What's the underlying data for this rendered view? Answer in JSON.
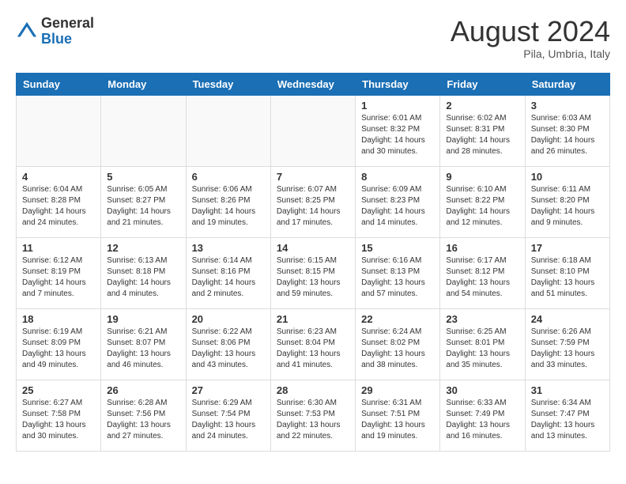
{
  "header": {
    "logo_general": "General",
    "logo_blue": "Blue",
    "month_title": "August 2024",
    "location": "Pila, Umbria, Italy"
  },
  "days_of_week": [
    "Sunday",
    "Monday",
    "Tuesday",
    "Wednesday",
    "Thursday",
    "Friday",
    "Saturday"
  ],
  "weeks": [
    [
      {
        "day": "",
        "info": ""
      },
      {
        "day": "",
        "info": ""
      },
      {
        "day": "",
        "info": ""
      },
      {
        "day": "",
        "info": ""
      },
      {
        "day": "1",
        "info": "Sunrise: 6:01 AM\nSunset: 8:32 PM\nDaylight: 14 hours\nand 30 minutes."
      },
      {
        "day": "2",
        "info": "Sunrise: 6:02 AM\nSunset: 8:31 PM\nDaylight: 14 hours\nand 28 minutes."
      },
      {
        "day": "3",
        "info": "Sunrise: 6:03 AM\nSunset: 8:30 PM\nDaylight: 14 hours\nand 26 minutes."
      }
    ],
    [
      {
        "day": "4",
        "info": "Sunrise: 6:04 AM\nSunset: 8:28 PM\nDaylight: 14 hours\nand 24 minutes."
      },
      {
        "day": "5",
        "info": "Sunrise: 6:05 AM\nSunset: 8:27 PM\nDaylight: 14 hours\nand 21 minutes."
      },
      {
        "day": "6",
        "info": "Sunrise: 6:06 AM\nSunset: 8:26 PM\nDaylight: 14 hours\nand 19 minutes."
      },
      {
        "day": "7",
        "info": "Sunrise: 6:07 AM\nSunset: 8:25 PM\nDaylight: 14 hours\nand 17 minutes."
      },
      {
        "day": "8",
        "info": "Sunrise: 6:09 AM\nSunset: 8:23 PM\nDaylight: 14 hours\nand 14 minutes."
      },
      {
        "day": "9",
        "info": "Sunrise: 6:10 AM\nSunset: 8:22 PM\nDaylight: 14 hours\nand 12 minutes."
      },
      {
        "day": "10",
        "info": "Sunrise: 6:11 AM\nSunset: 8:20 PM\nDaylight: 14 hours\nand 9 minutes."
      }
    ],
    [
      {
        "day": "11",
        "info": "Sunrise: 6:12 AM\nSunset: 8:19 PM\nDaylight: 14 hours\nand 7 minutes."
      },
      {
        "day": "12",
        "info": "Sunrise: 6:13 AM\nSunset: 8:18 PM\nDaylight: 14 hours\nand 4 minutes."
      },
      {
        "day": "13",
        "info": "Sunrise: 6:14 AM\nSunset: 8:16 PM\nDaylight: 14 hours\nand 2 minutes."
      },
      {
        "day": "14",
        "info": "Sunrise: 6:15 AM\nSunset: 8:15 PM\nDaylight: 13 hours\nand 59 minutes."
      },
      {
        "day": "15",
        "info": "Sunrise: 6:16 AM\nSunset: 8:13 PM\nDaylight: 13 hours\nand 57 minutes."
      },
      {
        "day": "16",
        "info": "Sunrise: 6:17 AM\nSunset: 8:12 PM\nDaylight: 13 hours\nand 54 minutes."
      },
      {
        "day": "17",
        "info": "Sunrise: 6:18 AM\nSunset: 8:10 PM\nDaylight: 13 hours\nand 51 minutes."
      }
    ],
    [
      {
        "day": "18",
        "info": "Sunrise: 6:19 AM\nSunset: 8:09 PM\nDaylight: 13 hours\nand 49 minutes."
      },
      {
        "day": "19",
        "info": "Sunrise: 6:21 AM\nSunset: 8:07 PM\nDaylight: 13 hours\nand 46 minutes."
      },
      {
        "day": "20",
        "info": "Sunrise: 6:22 AM\nSunset: 8:06 PM\nDaylight: 13 hours\nand 43 minutes."
      },
      {
        "day": "21",
        "info": "Sunrise: 6:23 AM\nSunset: 8:04 PM\nDaylight: 13 hours\nand 41 minutes."
      },
      {
        "day": "22",
        "info": "Sunrise: 6:24 AM\nSunset: 8:02 PM\nDaylight: 13 hours\nand 38 minutes."
      },
      {
        "day": "23",
        "info": "Sunrise: 6:25 AM\nSunset: 8:01 PM\nDaylight: 13 hours\nand 35 minutes."
      },
      {
        "day": "24",
        "info": "Sunrise: 6:26 AM\nSunset: 7:59 PM\nDaylight: 13 hours\nand 33 minutes."
      }
    ],
    [
      {
        "day": "25",
        "info": "Sunrise: 6:27 AM\nSunset: 7:58 PM\nDaylight: 13 hours\nand 30 minutes."
      },
      {
        "day": "26",
        "info": "Sunrise: 6:28 AM\nSunset: 7:56 PM\nDaylight: 13 hours\nand 27 minutes."
      },
      {
        "day": "27",
        "info": "Sunrise: 6:29 AM\nSunset: 7:54 PM\nDaylight: 13 hours\nand 24 minutes."
      },
      {
        "day": "28",
        "info": "Sunrise: 6:30 AM\nSunset: 7:53 PM\nDaylight: 13 hours\nand 22 minutes."
      },
      {
        "day": "29",
        "info": "Sunrise: 6:31 AM\nSunset: 7:51 PM\nDaylight: 13 hours\nand 19 minutes."
      },
      {
        "day": "30",
        "info": "Sunrise: 6:33 AM\nSunset: 7:49 PM\nDaylight: 13 hours\nand 16 minutes."
      },
      {
        "day": "31",
        "info": "Sunrise: 6:34 AM\nSunset: 7:47 PM\nDaylight: 13 hours\nand 13 minutes."
      }
    ]
  ]
}
